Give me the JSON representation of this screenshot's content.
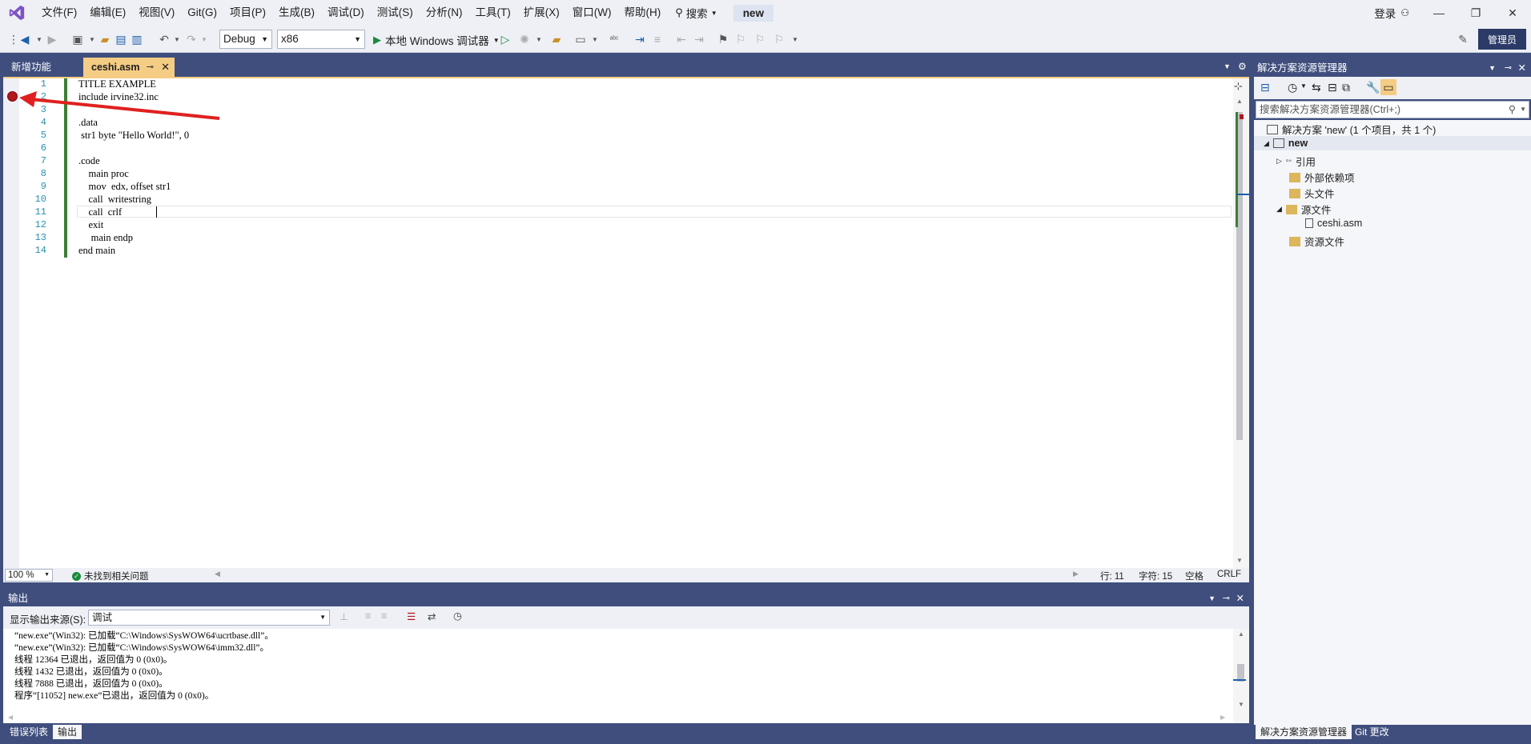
{
  "menubar": {
    "items": [
      "文件(F)",
      "编辑(E)",
      "视图(V)",
      "Git(G)",
      "项目(P)",
      "生成(B)",
      "调试(D)",
      "测试(S)",
      "分析(N)",
      "工具(T)",
      "扩展(X)",
      "窗口(W)",
      "帮助(H)"
    ],
    "search_label": "搜索",
    "solution_name": "new",
    "login": "登录"
  },
  "toolbar": {
    "config": "Debug",
    "platform": "x86",
    "run_label": "本地 Windows 调试器",
    "admin_label": "管理员"
  },
  "tabs": {
    "new_features": "新增功能",
    "file": "ceshi.asm"
  },
  "editor": {
    "line_numbers": [
      "1",
      "2",
      "3",
      "4",
      "5",
      "6",
      "7",
      "8",
      "9",
      "10",
      "11",
      "12",
      "13",
      "14"
    ],
    "lines": [
      "TITLE EXAMPLE",
      "include irvine32.inc",
      "",
      ".data",
      " str1 byte \"Hello World!\", 0",
      "",
      ".code",
      "    main proc",
      "    mov  edx, offset str1",
      "    call  writestring",
      "    call  crlf",
      "    exit",
      "     main endp",
      "end main"
    ]
  },
  "editor_status": {
    "zoom": "100 %",
    "issues": "未找到相关问题",
    "line": "行: 11",
    "char": "字符: 15",
    "space": "空格",
    "eol": "CRLF"
  },
  "output": {
    "title": "输出",
    "source_label": "显示输出来源(S):",
    "source_value": "调试",
    "lines": [
      "“new.exe”(Win32): 已加载“C:\\Windows\\SysWOW64\\ucrtbase.dll”。",
      "“new.exe”(Win32): 已加载“C:\\Windows\\SysWOW64\\imm32.dll”。",
      "线程 12364 已退出，返回值为 0 (0x0)。",
      "线程 1432 已退出，返回值为 0 (0x0)。",
      "线程 7888 已退出，返回值为 0 (0x0)。",
      "程序“[11052] new.exe”已退出，返回值为 0 (0x0)。"
    ]
  },
  "bottom_tabs": {
    "errors": "错误列表",
    "output": "输出"
  },
  "solution_explorer": {
    "title": "解决方案资源管理器",
    "search_placeholder": "搜索解决方案资源管理器(Ctrl+;)",
    "solution_line": "解决方案 'new' (1 个项目，共 1 个)",
    "project": "new",
    "items": {
      "references": "引用",
      "external": "外部依赖项",
      "headers": "头文件",
      "sources": "源文件",
      "file": "ceshi.asm",
      "resources": "资源文件"
    },
    "bottom_tab_1": "解决方案资源管理器",
    "bottom_tab_2": "Git 更改"
  },
  "colors": {
    "accent": "#3f4e7d",
    "active_tab": "#f5cc84",
    "breakpoint": "#b4161b",
    "annotation_arrow": "#e02020"
  }
}
